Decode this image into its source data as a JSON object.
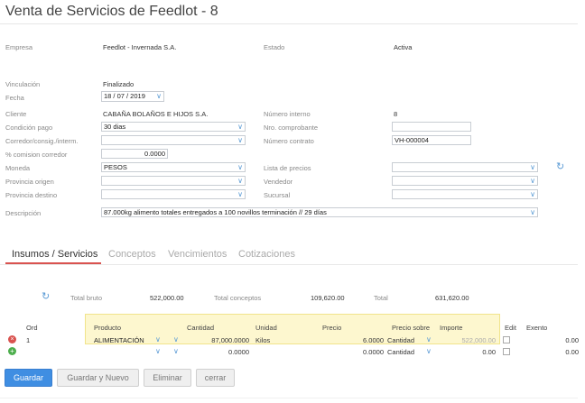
{
  "title": "Venta de Servicios de Feedlot - 8",
  "form": {
    "empresa_label": "Empresa",
    "empresa_value": "Feedlot - Invernada S.A.",
    "estado_label": "Estado",
    "estado_value": "Activa",
    "vinculacion_label": "Vinculación",
    "vinculacion_value": "Finalizado",
    "fecha_label": "Fecha",
    "fecha_value": "18 / 07 /  2019",
    "cliente_label": "Cliente",
    "cliente_value": "CABAÑA BOLAÑOS E HIJOS S.A.",
    "numero_interno_label": "Número interno",
    "numero_interno_value": "8",
    "condicion_pago_label": "Condición pago",
    "condicion_pago_value": "30 dias",
    "nro_comprobante_label": "Nro. comprobante",
    "nro_comprobante_value": "",
    "corredor_label": "Corredor/consig./interm.",
    "corredor_value": "",
    "numero_contrato_label": "Número contrato",
    "numero_contrato_value": "VH-000004",
    "comision_label": "% comision corredor",
    "comision_value": "0.0000",
    "moneda_label": "Moneda",
    "moneda_value": "PESOS",
    "lista_precios_label": "Lista de precios",
    "lista_precios_value": "",
    "provincia_origen_label": "Provincia origen",
    "provincia_origen_value": "",
    "vendedor_label": "Vendedor",
    "vendedor_value": "",
    "provincia_destino_label": "Provincia destino",
    "provincia_destino_value": "",
    "sucursal_label": "Sucursal",
    "sucursal_value": "",
    "descripcion_label": "Descripción",
    "descripcion_value": "87.000kg alimento totales entregados a 100 novillos terminación // 29 días"
  },
  "tabs": [
    "Insumos / Servicios",
    "Conceptos",
    "Vencimientos",
    "Cotizaciones"
  ],
  "totals": {
    "bruto_label": "Total bruto",
    "bruto_value": "522,000.00",
    "conceptos_label": "Total conceptos",
    "conceptos_value": "109,620.00",
    "total_label": "Total",
    "total_value": "631,620.00"
  },
  "table": {
    "headers": {
      "ord": "Ord",
      "producto": "Producto",
      "cantidad": "Cantidad",
      "unidad": "Unidad",
      "precio": "Precio",
      "precio_sobre": "Precio sobre",
      "importe": "Importe",
      "edit": "Edit",
      "exento": "Exento"
    },
    "rows": [
      {
        "ord": "1",
        "producto": "ALIMENTACIÓN",
        "cantidad": "87,000.0000",
        "unidad": "Kilos",
        "precio": "6.0000",
        "precio_sobre": "Cantidad",
        "importe": "522,000.00",
        "exento": "0.00"
      },
      {
        "ord": "",
        "producto": "",
        "cantidad": "0.0000",
        "unidad": "",
        "precio": "0.0000",
        "precio_sobre": "Cantidad",
        "importe": "0.00",
        "exento": "0.00"
      }
    ]
  },
  "buttons": {
    "guardar": "Guardar",
    "guardar_nuevo": "Guardar y Nuevo",
    "eliminar": "Eliminar",
    "cerrar": "cerrar"
  },
  "icons": {
    "delete_row": "remove-circle-icon",
    "add_row": "add-circle-icon",
    "refresh": "refresh-icon",
    "dropdown": "chevron-down-icon"
  },
  "colors": {
    "primary": "#3f8ee2",
    "tab_active_underline": "#d9534f",
    "row_highlight": "#fdf7cf",
    "delete_icon": "#d9534f",
    "add_icon": "#4cae4c"
  }
}
